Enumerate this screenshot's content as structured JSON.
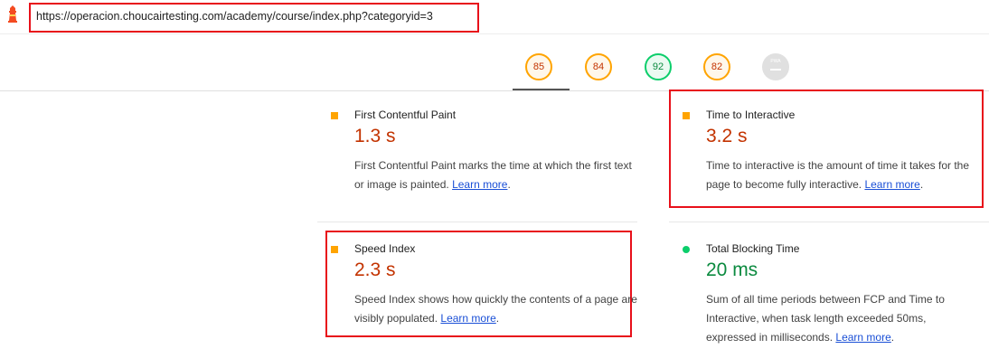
{
  "address_bar": {
    "url": "https://operacion.choucairtesting.com/academy/course/index.php?categoryid=3",
    "lock_icon": "lighthouse-icon"
  },
  "gauges": [
    {
      "score": "85",
      "category": "performance",
      "color": "#ffa400",
      "fraction": 0.85
    },
    {
      "score": "84",
      "category": "accessibility",
      "color": "#ffa400",
      "fraction": 0.84
    },
    {
      "score": "92",
      "category": "best-practices",
      "color": "#0cce6b",
      "fraction": 0.92
    },
    {
      "score": "82",
      "category": "seo",
      "color": "#ffa400",
      "fraction": 0.82
    },
    {
      "score": "PWA",
      "category": "pwa",
      "color": "#cccccc",
      "fraction": 0
    }
  ],
  "metrics": {
    "fcp": {
      "title": "First Contentful Paint",
      "value": "1.3 s",
      "desc": "First Contentful Paint marks the time at which the first text or image is painted.",
      "link": "Learn more",
      "tail": ".",
      "status_color": "#ffa400"
    },
    "tti": {
      "title": "Time to Interactive",
      "value": "3.2 s",
      "desc": "Time to interactive is the amount of time it takes for the page to become fully interactive.",
      "link": "Learn more",
      "tail": ".",
      "status_color": "#ffa400"
    },
    "si": {
      "title": "Speed Index",
      "value": "2.3 s",
      "desc": "Speed Index shows how quickly the contents of a page are visibly populated.",
      "link": "Learn more",
      "tail": ".",
      "status_color": "#ffa400"
    },
    "tbt": {
      "title": "Total Blocking Time",
      "value": "20 ms",
      "desc": "Sum of all time periods between FCP and Time to Interactive, when task length exceeded 50ms, expressed in milliseconds.",
      "link": "Learn more",
      "tail": ".",
      "status_color": "#0cce6b"
    }
  }
}
